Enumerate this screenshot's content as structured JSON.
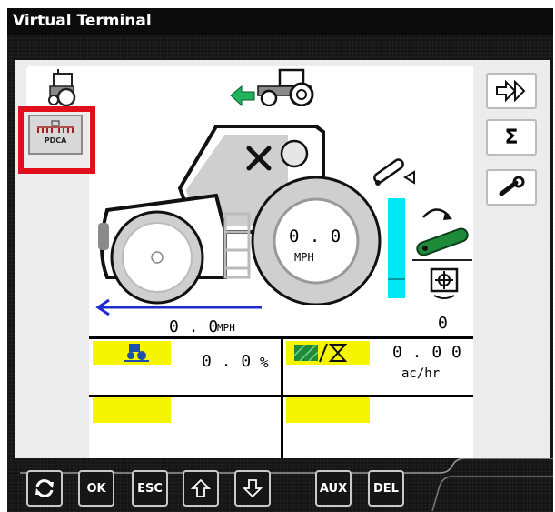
{
  "window": {
    "title": "Virtual Terminal"
  },
  "left_panel": {
    "pdca_label": "PDCA"
  },
  "tractor": {
    "speed_value": "0 . 0",
    "speed_unit": "MPH"
  },
  "ground_speed": {
    "value": "0 . 0",
    "unit": "MPH"
  },
  "pto": {
    "value": "0"
  },
  "cells": {
    "slip": {
      "value": "0 . 0",
      "unit": "%"
    },
    "work_rate": {
      "value": "0 . 0 0",
      "unit": "ac/hr"
    }
  },
  "softkeys": [
    {
      "name": "softkey-navigate",
      "glyph": "⇨"
    },
    {
      "name": "softkey-totals",
      "glyph": "Σ"
    },
    {
      "name": "softkey-settings",
      "glyph": "wrench-icon"
    }
  ],
  "hardkeys": {
    "refresh": "refresh-icon",
    "ok": "OK",
    "esc": "ESC",
    "up": "up-arrow-icon",
    "down": "down-arrow-icon",
    "aux": "AUX",
    "del": "DEL"
  },
  "colors": {
    "highlight_yellow": "#f5f500",
    "speed_arrow_blue": "#1f2bd1",
    "pto_bar_cyan": "#00e8f5",
    "selection_red": "#e0101a",
    "back_arrow_green": "#1fb35b",
    "belt_green": "#1d8b3a"
  }
}
